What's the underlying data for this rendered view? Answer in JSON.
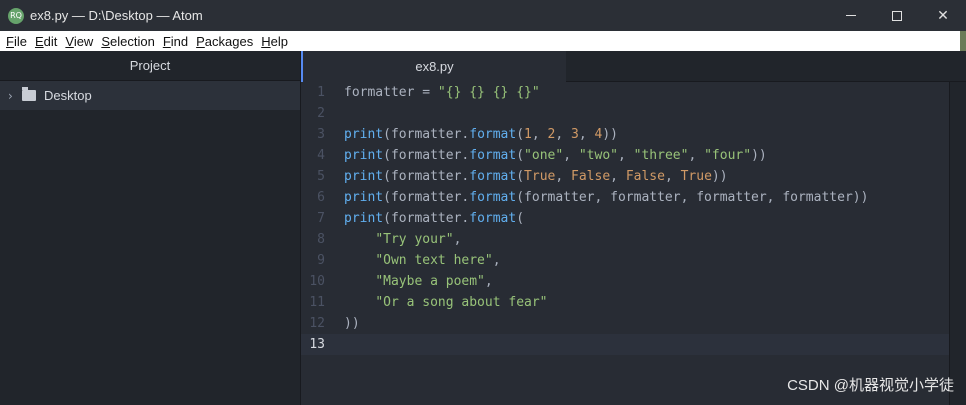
{
  "window": {
    "title": "ex8.py — D:\\Desktop — Atom",
    "app_icon_text": "RQ",
    "minimize_label": "",
    "maximize_label": "",
    "close_label": "✕"
  },
  "menu": [
    {
      "mnemonic": "F",
      "rest": "ile"
    },
    {
      "mnemonic": "E",
      "rest": "dit"
    },
    {
      "mnemonic": "V",
      "rest": "iew"
    },
    {
      "mnemonic": "S",
      "rest": "election"
    },
    {
      "mnemonic": "F",
      "rest": "ind"
    },
    {
      "mnemonic": "P",
      "rest": "ackages"
    },
    {
      "mnemonic": "H",
      "rest": "elp"
    }
  ],
  "tree": {
    "header": "Project",
    "root_folder": "Desktop"
  },
  "editor": {
    "tab_title": "ex8.py",
    "line_numbers": [
      "1",
      "2",
      "3",
      "4",
      "5",
      "6",
      "7",
      "8",
      "9",
      "10",
      "11",
      "12",
      "13"
    ],
    "current_line": 13
  },
  "code": {
    "l1a": "formatter = ",
    "l1b": "\"{} {} {} {}\"",
    "print": "print",
    "fmt": "formatter.",
    "format": "format",
    "l3": [
      "1",
      "2",
      "3",
      "4"
    ],
    "l4": [
      "\"one\"",
      "\"two\"",
      "\"three\"",
      "\"four\""
    ],
    "l5": [
      "True",
      "False",
      "False",
      "True"
    ],
    "l6_args": "formatter, formatter, formatter, formatter",
    "l8": "\"Try your\"",
    "l9": "\"Own text here\"",
    "l10": "\"Maybe a poem\"",
    "l11": "\"Or a song about fear\"",
    "l12": "))"
  },
  "watermark": "CSDN @机器视觉小学徒",
  "colors": {
    "background": "#282c34",
    "function": "#61afef",
    "string": "#98c379",
    "number": "#d19a66"
  }
}
